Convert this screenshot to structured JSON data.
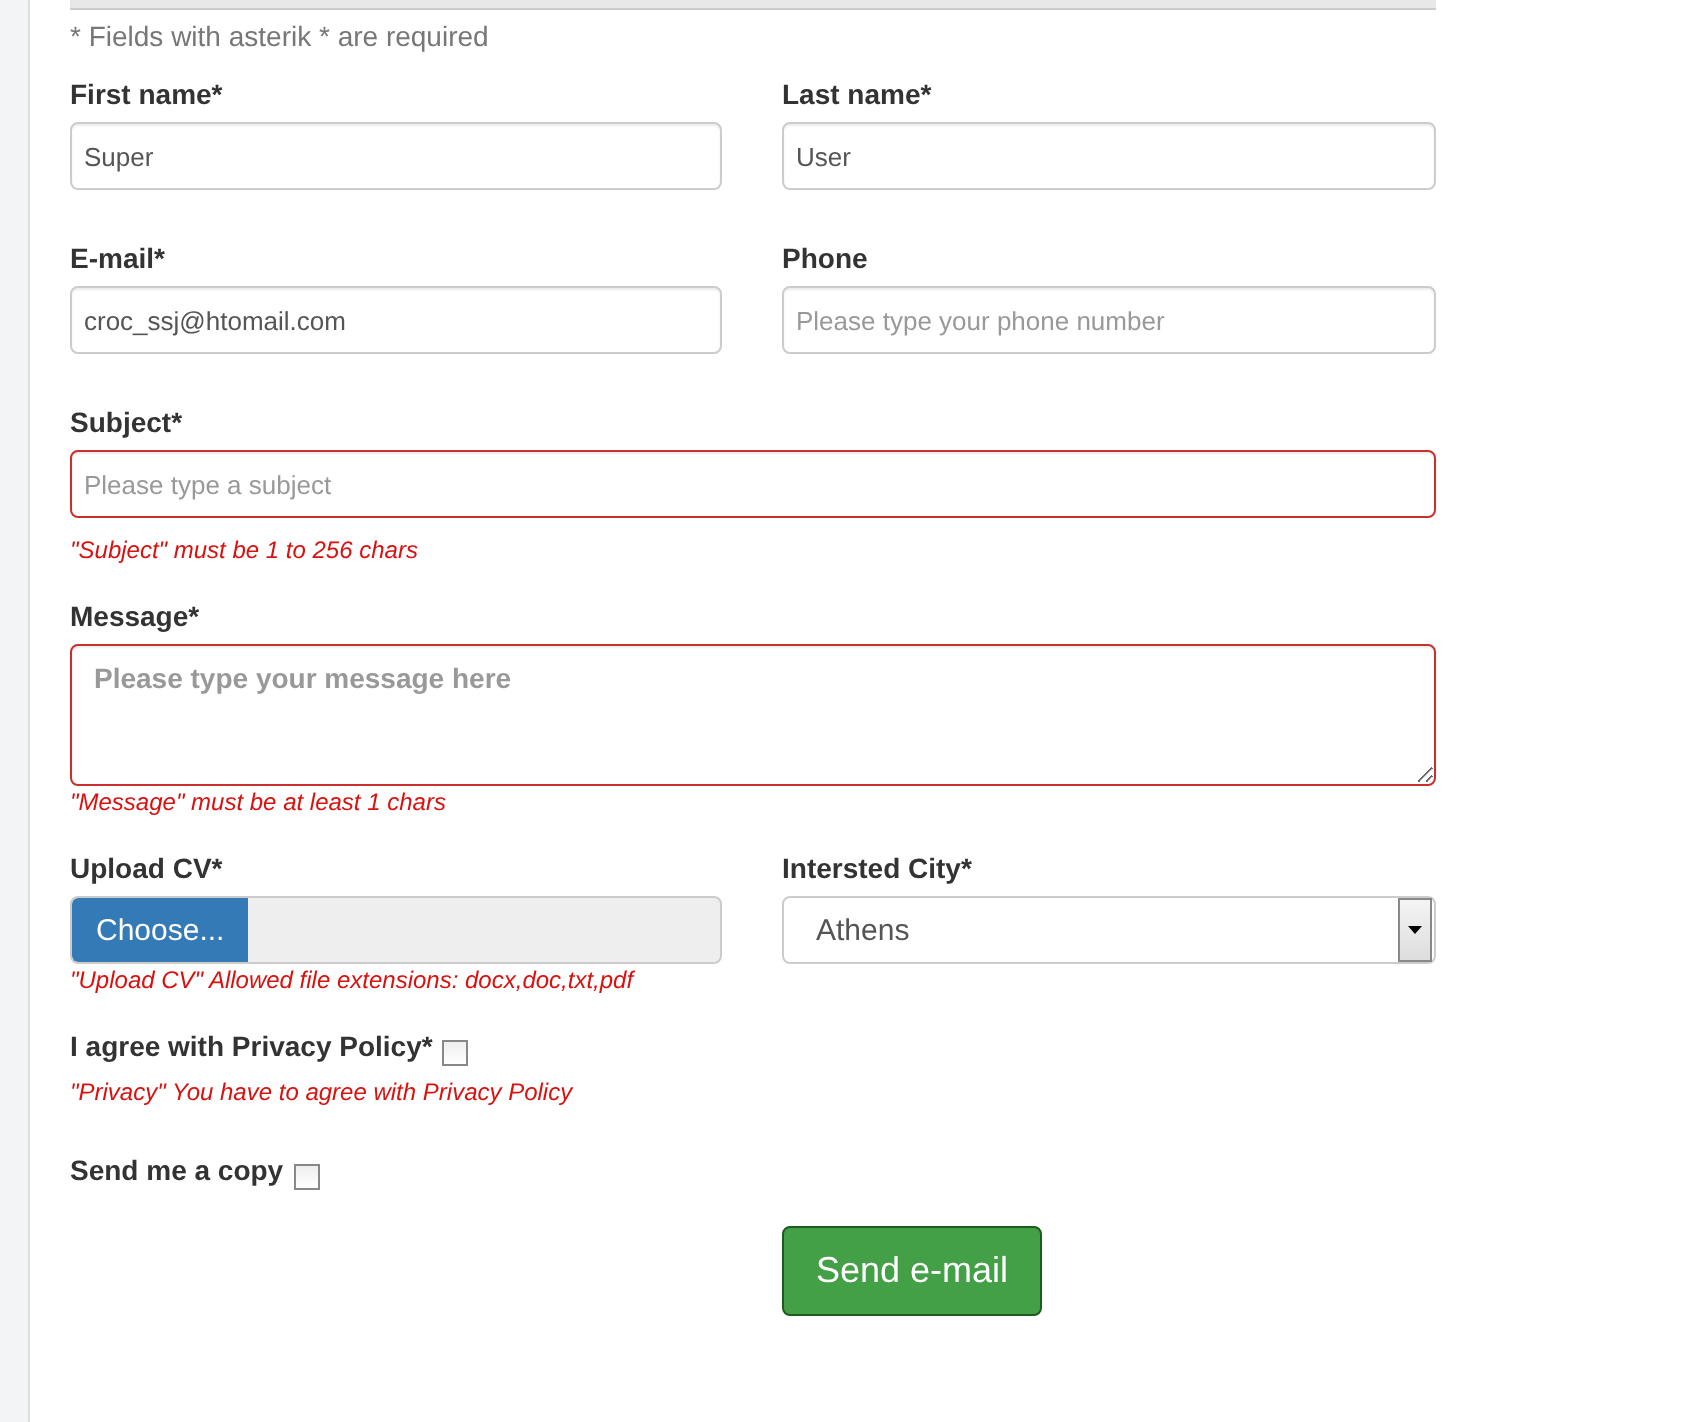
{
  "note": "* Fields with asterik * are required",
  "rows": [
    [
      {
        "kind": "text",
        "label": "First name*",
        "value": "Super",
        "invalid": false
      },
      {
        "kind": "text",
        "label": "Last name*",
        "value": "User",
        "invalid": false
      }
    ],
    [
      {
        "kind": "text",
        "label": "E-mail*",
        "value": "croc_ssj@htomail.com",
        "invalid": false
      },
      {
        "kind": "text",
        "label": "Phone",
        "placeholder": "Please type your phone number",
        "invalid": false
      }
    ],
    [
      {
        "kind": "text",
        "label": "Subject*",
        "placeholder": "Please type a subject",
        "invalid": true,
        "error": "\"Subject\" must be 1 to 256 chars"
      }
    ],
    [
      {
        "kind": "textarea",
        "label": "Message*",
        "placeholder": "Please type your message here",
        "invalid": true,
        "error": "\"Message\" must be at least 1 chars"
      }
    ],
    [
      {
        "kind": "file",
        "label": "Upload CV*",
        "button": "Choose...",
        "error": "\"Upload CV\" Allowed file extensions: docx,doc,txt,pdf"
      },
      {
        "kind": "select",
        "label": "Intersted City*",
        "value": "Athens"
      }
    ],
    [
      {
        "kind": "checkbox",
        "label": "I agree with Privacy Policy*",
        "checked": false,
        "error": "\"Privacy\" You have to agree with Privacy Policy"
      }
    ],
    [
      {
        "kind": "checkbox",
        "label": "Send me a copy",
        "checked": false
      }
    ]
  ],
  "submit": "Send e-mail"
}
